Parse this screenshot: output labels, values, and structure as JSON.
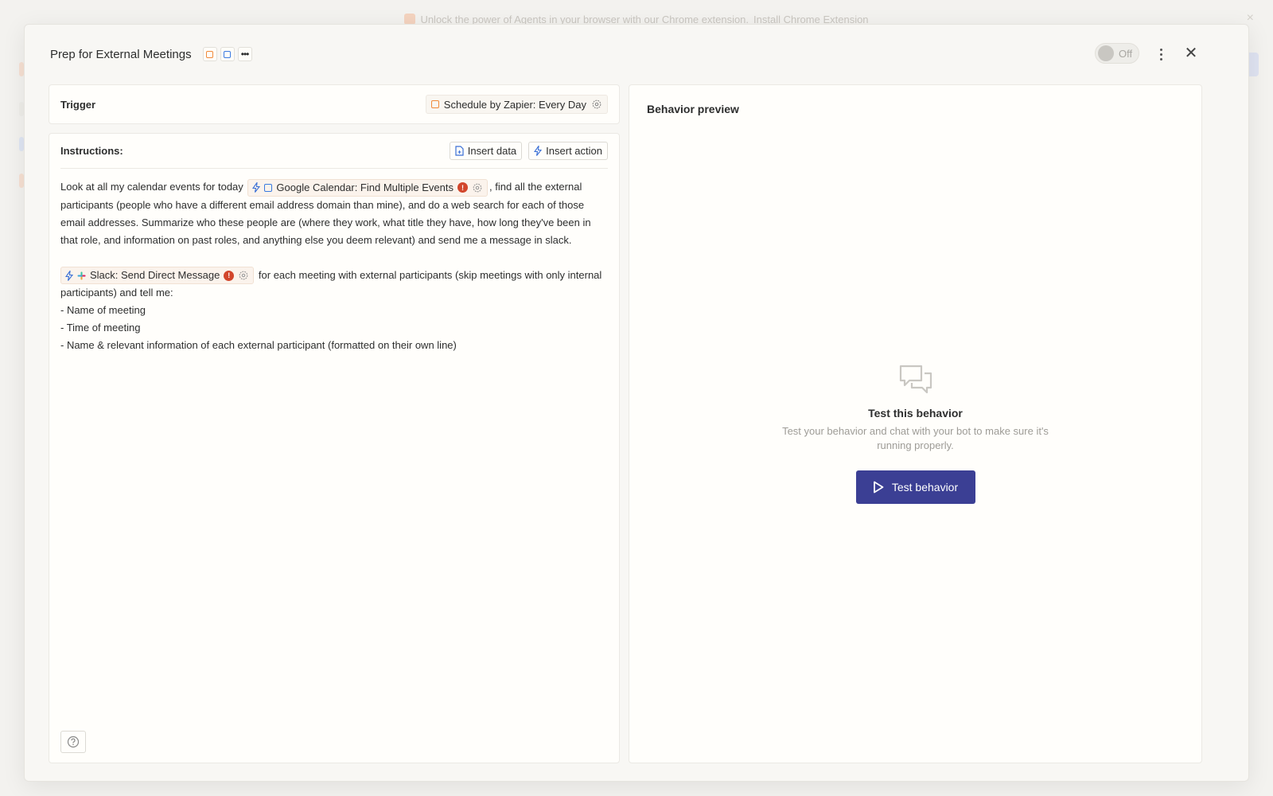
{
  "background": {
    "banner_text": "Unlock the power of Agents in your browser with our Chrome extension.",
    "banner_link": "Install Chrome Extension"
  },
  "modal": {
    "title": "Prep for External Meetings",
    "toggle_label": "Off",
    "toggle_state": "off"
  },
  "trigger": {
    "label": "Trigger",
    "schedule_chip": "Schedule by Zapier: Every Day"
  },
  "instructions": {
    "label": "Instructions:",
    "insert_data": "Insert data",
    "insert_action": "Insert action",
    "para1_before": "Look at all my calendar events for today",
    "calendar_chip": "Google Calendar: Find Multiple Events",
    "para1_after": ", find all the external participants (people who have a different email address domain than mine), and do a web search for each of those email addresses. Summarize who these people are (where they work, what title they have, how long they've been in that role, and information on past roles, and anything else you deem relevant) and send me a message in slack.",
    "slack_chip": "Slack: Send Direct Message",
    "para2_after": "for each meeting with external participants (skip meetings with only internal participants) and tell me:",
    "list": [
      "- Name of meeting",
      "- Time of meeting",
      "- Name & relevant information of each external participant (formatted on their own line)"
    ]
  },
  "preview": {
    "title": "Behavior preview",
    "empty_title": "Test this behavior",
    "empty_desc": "Test your behavior and chat with your bot to make sure it's running properly.",
    "test_button": "Test behavior"
  },
  "colors": {
    "primary": "#3b3f94",
    "warning": "#d2462c",
    "zapier_orange": "#f08a3a",
    "calendar_blue": "#3a7ae0"
  }
}
